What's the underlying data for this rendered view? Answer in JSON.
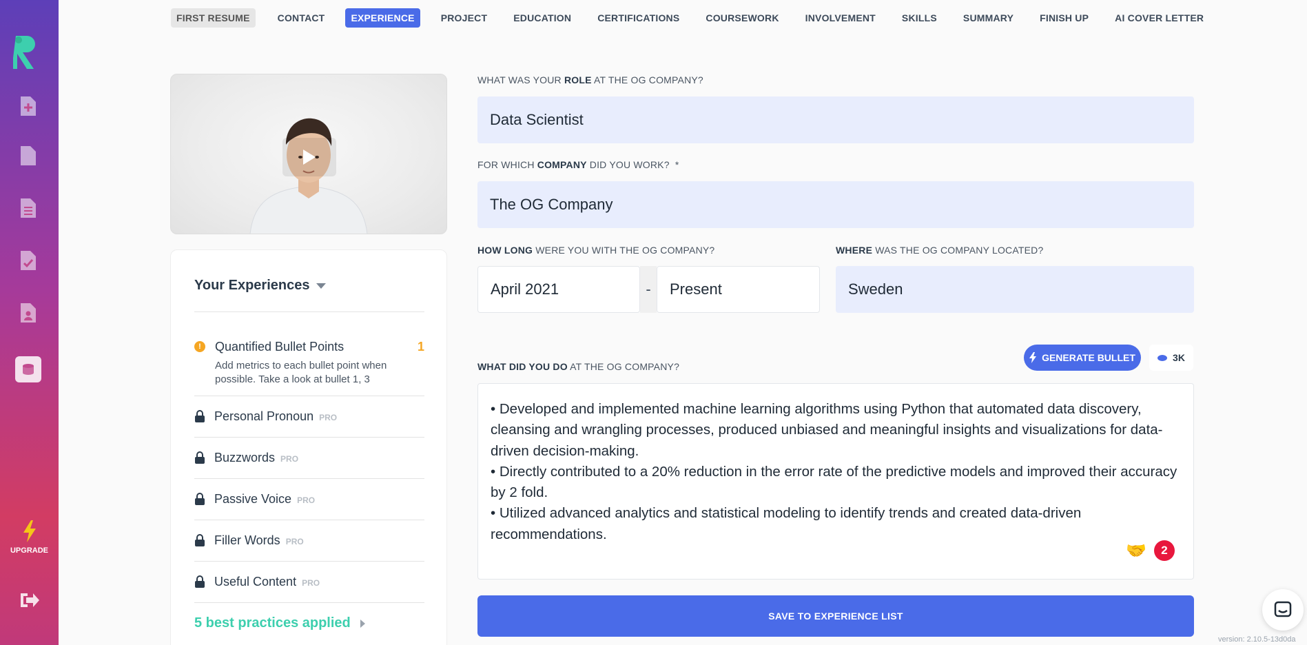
{
  "rail": {
    "upgrade_label": "UPGRADE"
  },
  "tabs": [
    {
      "label": "FIRST RESUME"
    },
    {
      "label": "CONTACT"
    },
    {
      "label": "EXPERIENCE"
    },
    {
      "label": "PROJECT"
    },
    {
      "label": "EDUCATION"
    },
    {
      "label": "CERTIFICATIONS"
    },
    {
      "label": "COURSEWORK"
    },
    {
      "label": "INVOLVEMENT"
    },
    {
      "label": "SKILLS"
    },
    {
      "label": "SUMMARY"
    },
    {
      "label": "FINISH UP"
    },
    {
      "label": "AI COVER LETTER"
    }
  ],
  "panel": {
    "title": "Your Experiences",
    "quantified": {
      "title": "Quantified Bullet Points",
      "count": "1",
      "description": "Add metrics to each bullet point when possible. Take a look at bullet 1, 3"
    },
    "pro_badge": "PRO",
    "pro_items": [
      "Personal Pronoun",
      "Buzzwords",
      "Passive Voice",
      "Filler Words",
      "Useful Content"
    ],
    "practices": "5 best practices applied"
  },
  "form": {
    "role_label_pre": "WHAT WAS YOUR ",
    "role_label_bold": "ROLE",
    "role_label_post": " AT THE OG COMPANY?",
    "role_value": "Data Scientist",
    "company_label_pre": "FOR WHICH ",
    "company_label_bold": "COMPANY",
    "company_label_post": " DID YOU WORK?  *",
    "company_value": "The OG Company",
    "howlong_label_bold": "HOW LONG",
    "howlong_label_post": " WERE YOU WITH THE OG COMPANY?",
    "start_date": "April 2021",
    "date_separator": "-",
    "end_date": "Present",
    "where_label_bold": "WHERE",
    "where_label_post": " WAS THE OG COMPANY LOCATED?",
    "location_value": "Sweden",
    "what_label_bold": "WHAT DID YOU DO",
    "what_label_post": " AT THE OG COMPANY?",
    "generate_label": "GENERATE BULLET",
    "credits": "3K",
    "bullets": [
      "• Developed and implemented machine learning algorithms using Python that automated data discovery, cleansing and wrangling processes, produced unbiased and meaningful insights and visualizations for data-driven decision-making.",
      "• Directly contributed to a 20% reduction in the error rate of the predictive models and improved their accuracy by 2 fold.",
      "• Utilized advanced analytics and statistical modeling to identify trends and created data-driven recommendations."
    ],
    "issue_count": "2",
    "save_label": "SAVE TO EXPERIENCE LIST"
  },
  "version": "version: 2.10.5-13d0da"
}
